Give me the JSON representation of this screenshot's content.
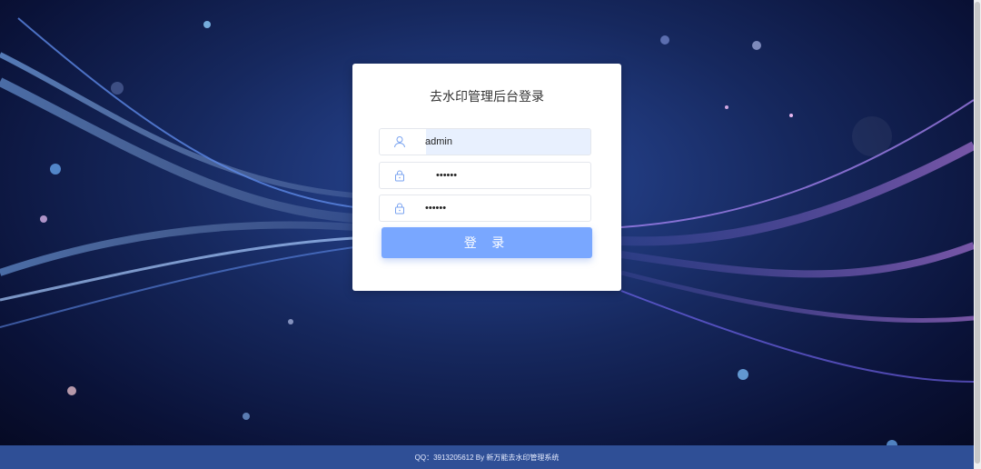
{
  "page": {
    "title": "去水印管理后台登录"
  },
  "form": {
    "username_value": "admin",
    "password_value": "••••••",
    "confirm_value": "••••••",
    "username_icon": "user-icon",
    "password_icon": "lock-icon",
    "confirm_icon": "lock-icon",
    "submit_label": "登 录"
  },
  "footer": {
    "text": "QQ：3913205612 By 新万能去水印管理系统"
  },
  "colors": {
    "primary_button": "#79a7ff",
    "footer_bg": "#2f4f96",
    "icon": "#7aa3f0"
  }
}
